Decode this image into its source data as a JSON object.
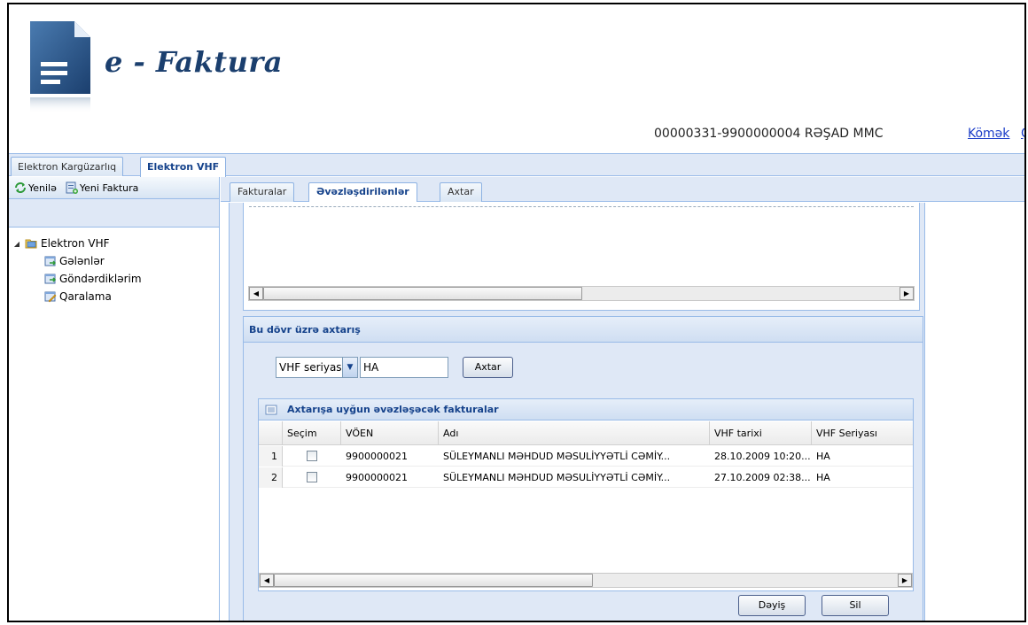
{
  "header": {
    "logo_text": "e - Faktura",
    "user_info": "00000331-9900000004 RƏŞAD MMC",
    "help_link": "Kömək",
    "extra_link": "Ç"
  },
  "top_tabs": [
    {
      "label": "Elektron Kargüzarlıq",
      "active": false
    },
    {
      "label": "Elektron VHF",
      "active": true
    }
  ],
  "left_toolbar": {
    "refresh_label": "Yenilə",
    "new_invoice_label": "Yeni Faktura"
  },
  "tree": {
    "root": "Elektron VHF",
    "children": [
      "Gələnlər",
      "Göndərdiklərim",
      "Qaralama"
    ]
  },
  "sub_tabs": [
    {
      "label": "Fakturalar",
      "active": false
    },
    {
      "label": "Əvəzləşdirilənlər",
      "active": true
    },
    {
      "label": "Axtar",
      "active": false
    }
  ],
  "search_panel": {
    "title": "Bu dövr üzrə axtarış",
    "select_value": "VHF seriyası",
    "input_value": "HA",
    "search_button": "Axtar"
  },
  "results_grid": {
    "title": "Axtarışa uyğun əvəzləşəcək fakturalar",
    "columns": [
      "Seçim",
      "VÖEN",
      "Adı",
      "VHF tarixi",
      "VHF Seriyası"
    ],
    "rows": [
      {
        "num": "1",
        "voen": "9900000021",
        "name": "SÜLEYMANLI MƏHDUD MƏSULİYYƏTLİ CƏMİY...",
        "date": "28.10.2009 10:20...",
        "series": "HA"
      },
      {
        "num": "2",
        "voen": "9900000021",
        "name": "SÜLEYMANLI MƏHDUD MƏSULİYYƏTLİ CƏMİY...",
        "date": "27.10.2009 02:38...",
        "series": "HA"
      }
    ]
  },
  "buttons": {
    "change": "Dəyiş",
    "delete": "Sil"
  }
}
